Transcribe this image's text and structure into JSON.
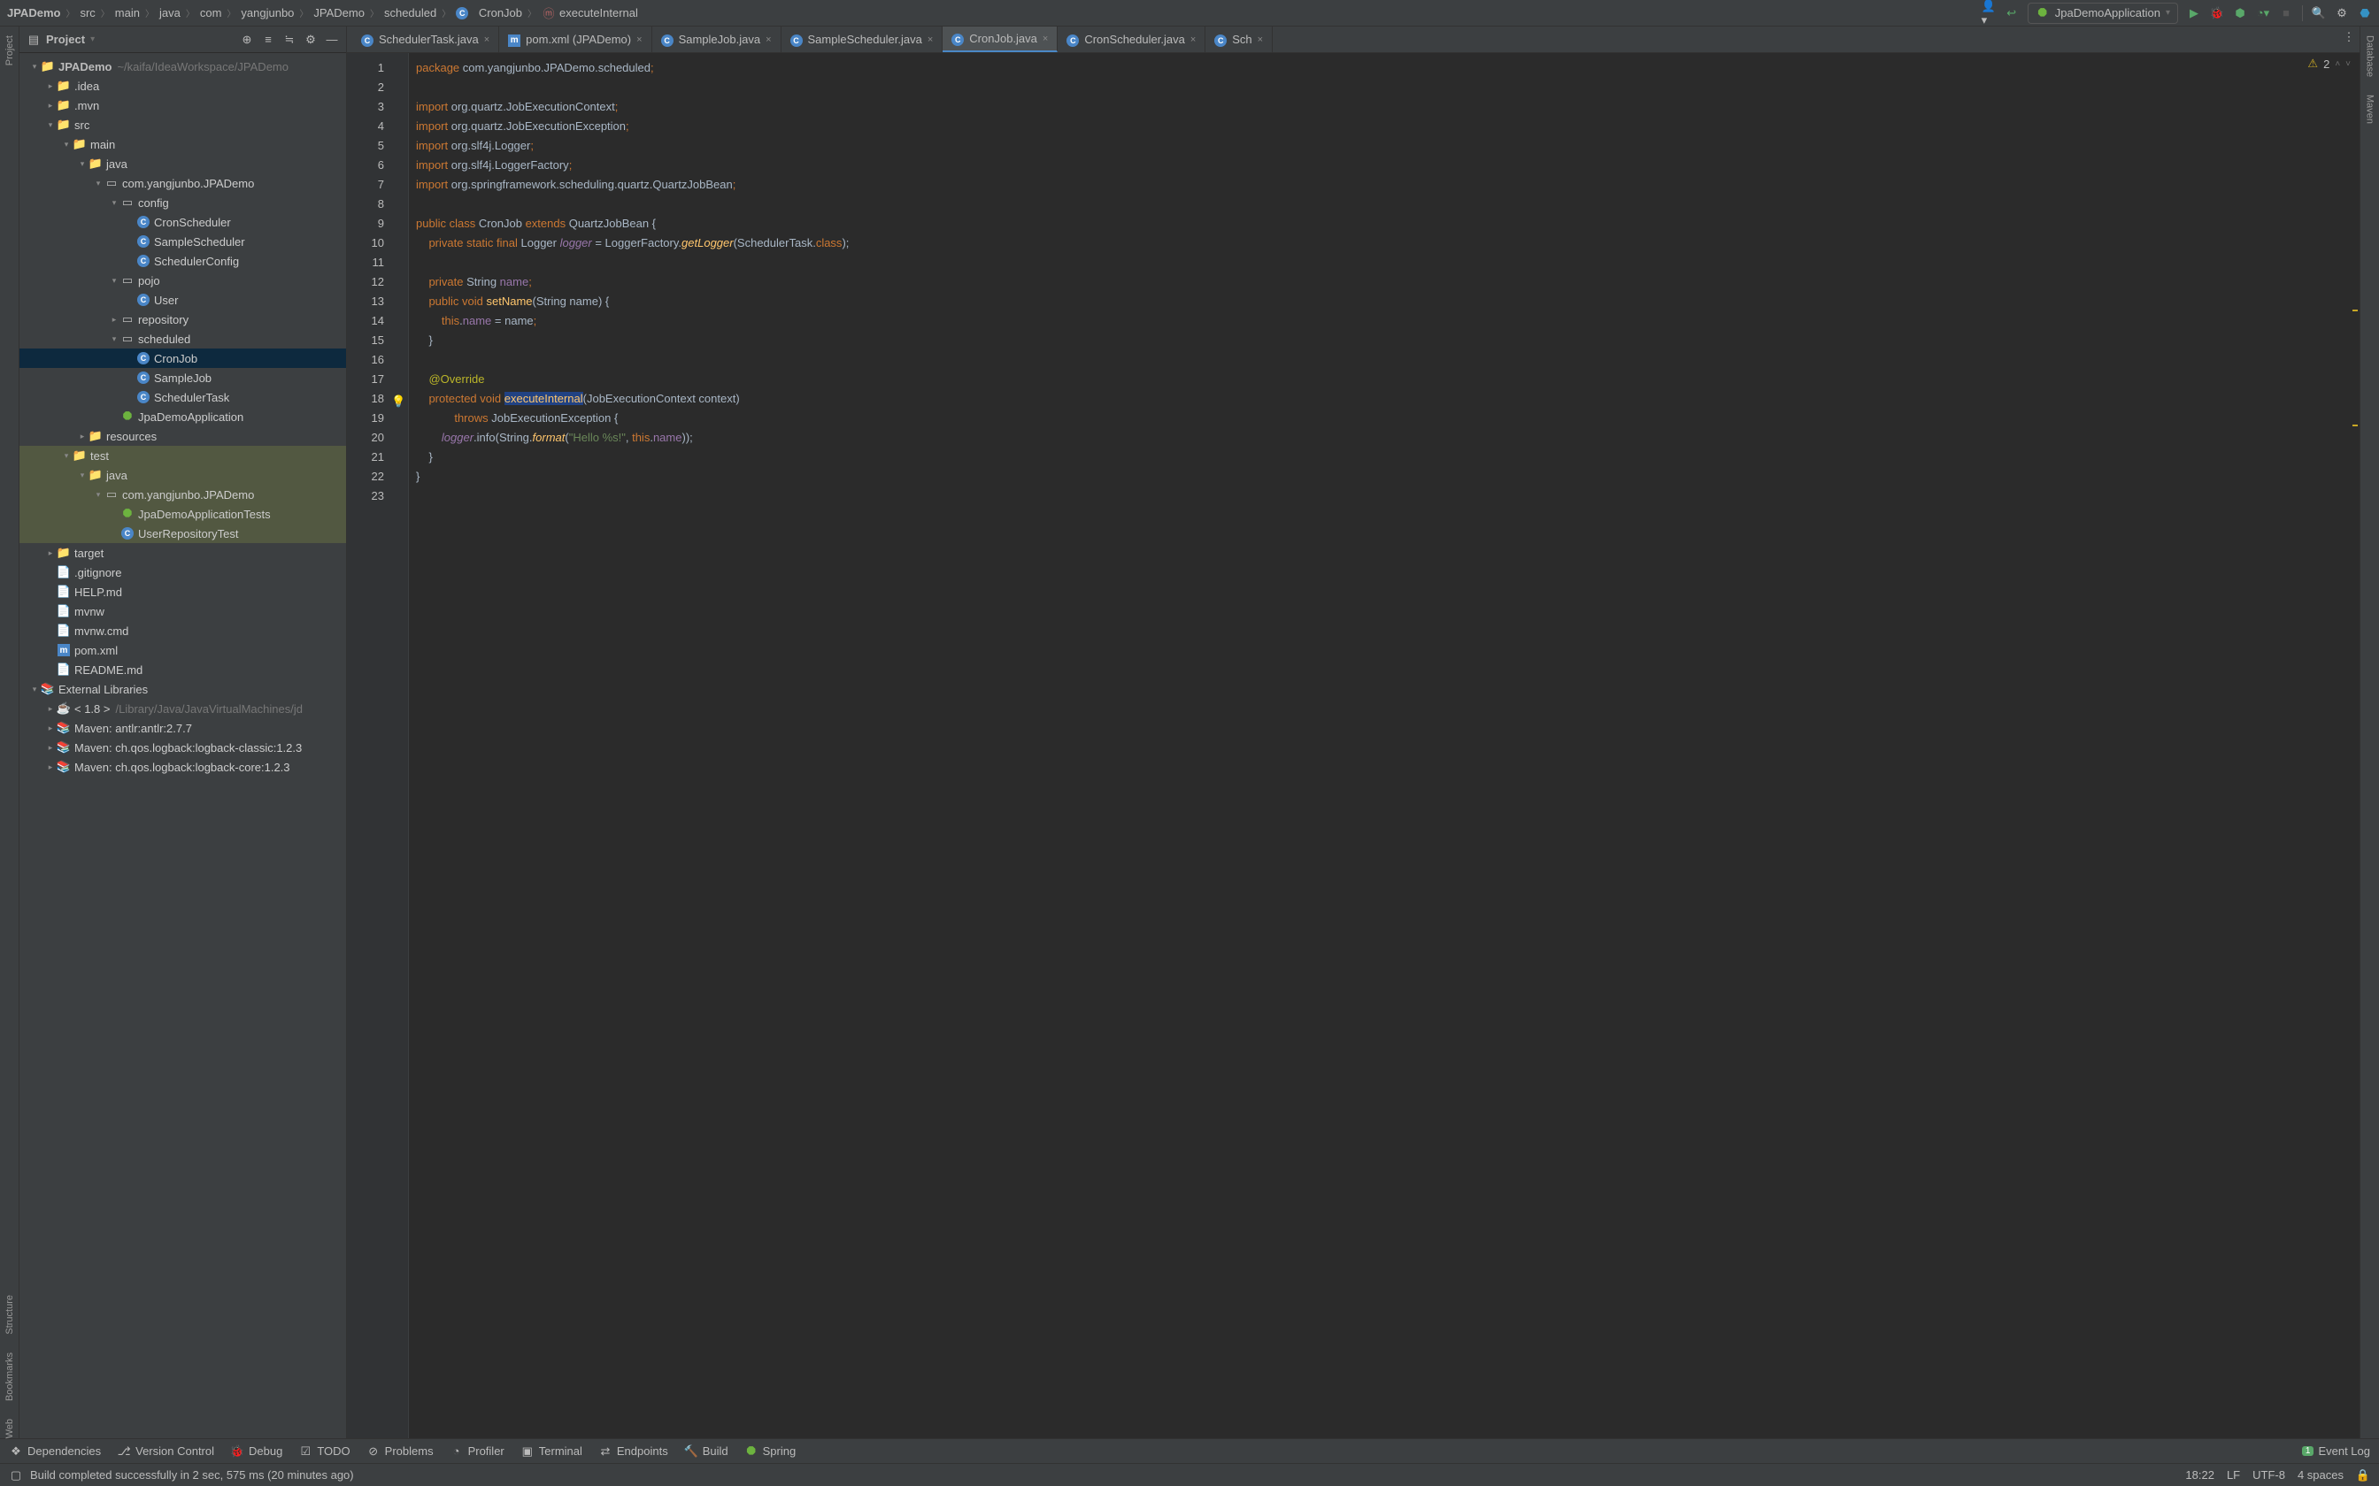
{
  "breadcrumb": [
    "JPADemo",
    "src",
    "main",
    "java",
    "com",
    "yangjunbo",
    "JPADemo",
    "scheduled",
    "CronJob",
    "executeInternal"
  ],
  "runConfig": {
    "label": "JpaDemoApplication"
  },
  "sidebar": {
    "title": "Project",
    "tree": [
      {
        "d": 0,
        "arrow": "▾",
        "icon": "folder",
        "label": "JPADemo",
        "muted": "~/kaifa/IdeaWorkspace/JPADemo",
        "bold": true
      },
      {
        "d": 1,
        "arrow": "▸",
        "icon": "folder",
        "label": ".idea"
      },
      {
        "d": 1,
        "arrow": "▸",
        "icon": "folder",
        "label": ".mvn"
      },
      {
        "d": 1,
        "arrow": "▾",
        "icon": "folder",
        "label": "src"
      },
      {
        "d": 2,
        "arrow": "▾",
        "icon": "folder",
        "label": "main"
      },
      {
        "d": 3,
        "arrow": "▾",
        "icon": "folder-src",
        "label": "java"
      },
      {
        "d": 4,
        "arrow": "▾",
        "icon": "pkg",
        "label": "com.yangjunbo.JPADemo"
      },
      {
        "d": 5,
        "arrow": "▾",
        "icon": "pkg",
        "label": "config"
      },
      {
        "d": 6,
        "arrow": "",
        "icon": "class",
        "label": "CronScheduler"
      },
      {
        "d": 6,
        "arrow": "",
        "icon": "class",
        "label": "SampleScheduler"
      },
      {
        "d": 6,
        "arrow": "",
        "icon": "class",
        "label": "SchedulerConfig"
      },
      {
        "d": 5,
        "arrow": "▾",
        "icon": "pkg",
        "label": "pojo"
      },
      {
        "d": 6,
        "arrow": "",
        "icon": "class",
        "label": "User"
      },
      {
        "d": 5,
        "arrow": "▸",
        "icon": "pkg",
        "label": "repository"
      },
      {
        "d": 5,
        "arrow": "▾",
        "icon": "pkg",
        "label": "scheduled"
      },
      {
        "d": 6,
        "arrow": "",
        "icon": "class",
        "label": "CronJob",
        "sel": true
      },
      {
        "d": 6,
        "arrow": "",
        "icon": "class",
        "label": "SampleJob"
      },
      {
        "d": 6,
        "arrow": "",
        "icon": "class",
        "label": "SchedulerTask"
      },
      {
        "d": 5,
        "arrow": "",
        "icon": "spring",
        "label": "JpaDemoApplication"
      },
      {
        "d": 3,
        "arrow": "▸",
        "icon": "folder-res",
        "label": "resources"
      },
      {
        "d": 2,
        "arrow": "▾",
        "icon": "folder",
        "label": "test",
        "hl": true
      },
      {
        "d": 3,
        "arrow": "▾",
        "icon": "folder-test",
        "label": "java",
        "hl": true
      },
      {
        "d": 4,
        "arrow": "▾",
        "icon": "pkg",
        "label": "com.yangjunbo.JPADemo",
        "hl": true
      },
      {
        "d": 5,
        "arrow": "",
        "icon": "spring",
        "label": "JpaDemoApplicationTests",
        "hl": true
      },
      {
        "d": 5,
        "arrow": "",
        "icon": "class",
        "label": "UserRepositoryTest",
        "hl": true
      },
      {
        "d": 1,
        "arrow": "▸",
        "icon": "folder-ex",
        "label": "target"
      },
      {
        "d": 1,
        "arrow": "",
        "icon": "file",
        "label": ".gitignore"
      },
      {
        "d": 1,
        "arrow": "",
        "icon": "md",
        "label": "HELP.md"
      },
      {
        "d": 1,
        "arrow": "",
        "icon": "file",
        "label": "mvnw"
      },
      {
        "d": 1,
        "arrow": "",
        "icon": "file",
        "label": "mvnw.cmd"
      },
      {
        "d": 1,
        "arrow": "",
        "icon": "maven",
        "label": "pom.xml"
      },
      {
        "d": 1,
        "arrow": "",
        "icon": "md",
        "label": "README.md"
      },
      {
        "d": 0,
        "arrow": "▾",
        "icon": "lib",
        "label": "External Libraries"
      },
      {
        "d": 1,
        "arrow": "▸",
        "icon": "jdk",
        "label": "< 1.8 >",
        "muted": "/Library/Java/JavaVirtualMachines/jd"
      },
      {
        "d": 1,
        "arrow": "▸",
        "icon": "lib",
        "label": "Maven: antlr:antlr:2.7.7"
      },
      {
        "d": 1,
        "arrow": "▸",
        "icon": "lib",
        "label": "Maven: ch.qos.logback:logback-classic:1.2.3"
      },
      {
        "d": 1,
        "arrow": "▸",
        "icon": "lib",
        "label": "Maven: ch.qos.logback:logback-core:1.2.3"
      }
    ]
  },
  "tabs": [
    {
      "icon": "class",
      "label": "SchedulerTask.java"
    },
    {
      "icon": "maven",
      "label": "pom.xml (JPADemo)"
    },
    {
      "icon": "class",
      "label": "SampleJob.java"
    },
    {
      "icon": "class",
      "label": "SampleScheduler.java"
    },
    {
      "icon": "class",
      "label": "CronJob.java",
      "active": true
    },
    {
      "icon": "class",
      "label": "CronScheduler.java"
    },
    {
      "icon": "class",
      "label": "Sch"
    }
  ],
  "inspection": {
    "warn": "2"
  },
  "code": {
    "lines": [
      "1",
      "2",
      "3",
      "4",
      "5",
      "6",
      "7",
      "8",
      "9",
      "10",
      "11",
      "12",
      "13",
      "14",
      "15",
      "16",
      "17",
      "18",
      "19",
      "20",
      "21",
      "22",
      "23"
    ],
    "l1a": "package ",
    "l1b": "com.yangjunbo.JPADemo.scheduled",
    "imp": "import ",
    "i1": "org.quartz.JobExecutionContext",
    "i2": "org.quartz.JobExecutionException",
    "i3": "org.slf4j.Logger",
    "i4": "org.slf4j.LoggerFactory",
    "i5": "org.springframework.scheduling.quartz.QuartzJobBean",
    "l9": "public class CronJob extends QuartzJobBean {",
    "l10": "    private static final Logger logger = LoggerFactory.getLogger(SchedulerTask.class);",
    "l12": "    private String name;",
    "l13": "    public void setName(String name) {",
    "l14": "        this.name = name;",
    "l15": "    }",
    "l17": "    @Override",
    "l18": "    protected void executeInternal(JobExecutionContext context)",
    "l19": "            throws JobExecutionException {",
    "l20": "        logger.info(String.format(\"Hello %s!\", this.name));",
    "l21": "    }",
    "l22": "}"
  },
  "toolwin": [
    "Dependencies",
    "Version Control",
    "Debug",
    "TODO",
    "Problems",
    "Profiler",
    "Terminal",
    "Endpoints",
    "Build",
    "Spring"
  ],
  "eventLog": {
    "count": "1",
    "label": "Event Log"
  },
  "status": {
    "msg": "Build completed successfully in 2 sec, 575 ms (20 minutes ago)",
    "time": "18:22",
    "enc1": "LF",
    "enc2": "UTF-8",
    "ind": "4 spaces"
  },
  "leftTabs": [
    "Project",
    "Structure",
    "Bookmarks",
    "Web"
  ],
  "rightTabs": [
    "Database",
    "Maven"
  ]
}
